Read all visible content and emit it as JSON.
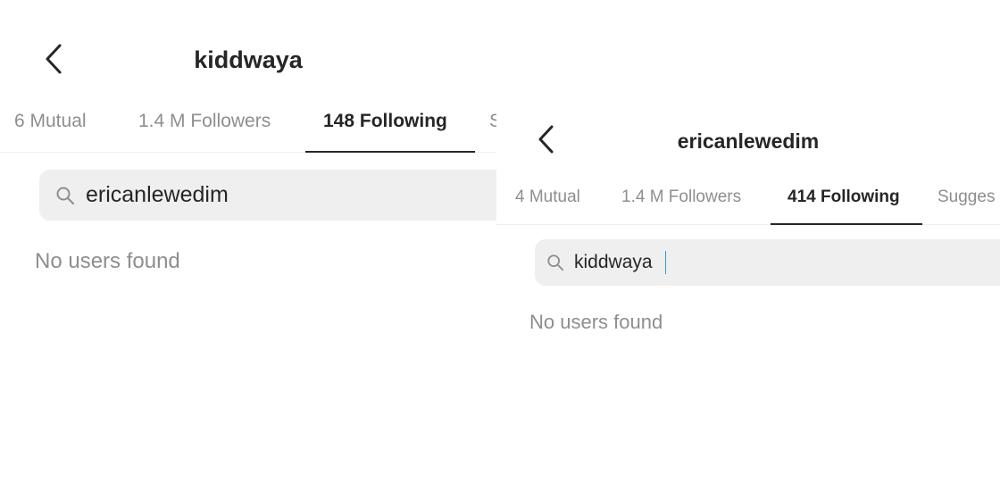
{
  "left": {
    "header": {
      "title": "kiddwaya"
    },
    "tabs": [
      {
        "label": "6 Mutual",
        "active": false
      },
      {
        "label": "1.4 M Followers",
        "active": false
      },
      {
        "label": "148 Following",
        "active": true
      },
      {
        "label": "S",
        "active": false
      }
    ],
    "search": {
      "value": "ericanlewedim"
    },
    "results": {
      "empty_message": "No users found"
    }
  },
  "right": {
    "header": {
      "title": "ericanlewedim"
    },
    "tabs": [
      {
        "label": "4 Mutual",
        "active": false
      },
      {
        "label": "1.4 M Followers",
        "active": false
      },
      {
        "label": "414 Following",
        "active": true
      },
      {
        "label": "Sugges",
        "active": false
      }
    ],
    "search": {
      "value": "kiddwaya"
    },
    "results": {
      "empty_message": "No users found"
    }
  },
  "colors": {
    "text_primary": "#262626",
    "text_secondary": "#8e8e8e",
    "search_bg": "#efefef",
    "divider": "#efefef",
    "caret": "#3897f0"
  },
  "icons": {
    "back": "chevron-left-icon",
    "search": "search-icon"
  }
}
